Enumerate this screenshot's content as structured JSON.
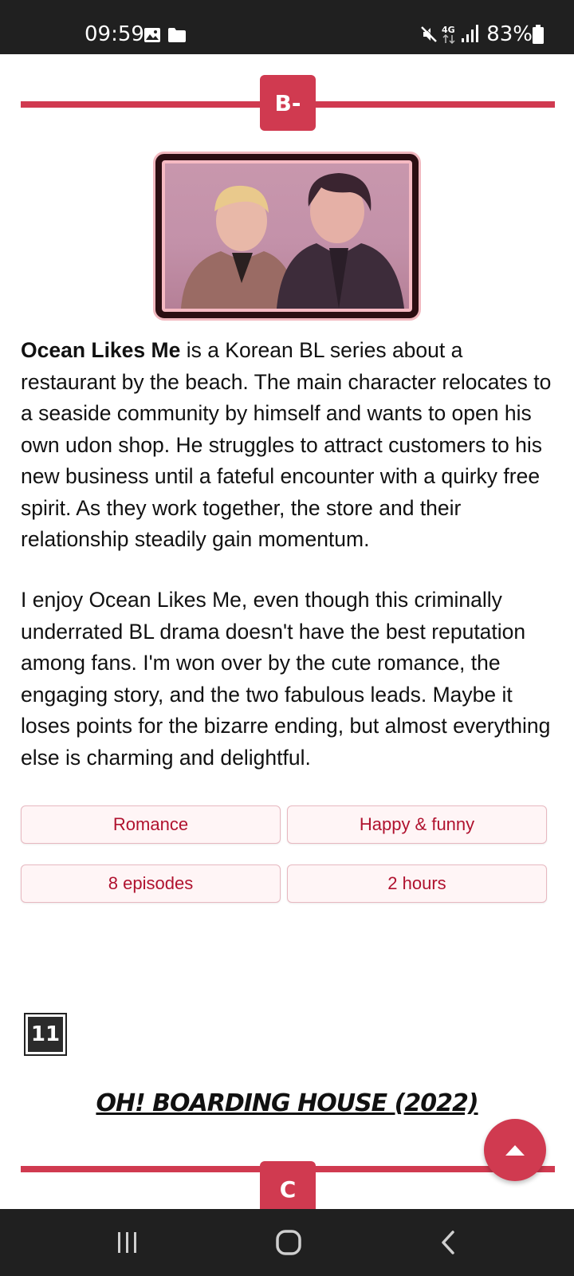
{
  "status_bar": {
    "time": "09:59",
    "network": "4G",
    "battery": "83%",
    "icons": [
      "image-icon",
      "folder-icon",
      "mute-icon",
      "network-4g-icon",
      "signal-icon",
      "battery-icon"
    ]
  },
  "review": {
    "grade": "B-",
    "title_bold": "Ocean Likes Me",
    "paragraph1_rest": " is a Korean BL series about a restaurant by the beach. The main character relocates to a seaside community by himself and wants to open his own udon shop. He struggles to attract customers to his new business until a fateful encounter with a quirky free spirit. As they work together, the store and their relationship steadily gain momentum.",
    "paragraph2": "I enjoy Ocean Likes Me, even though this criminally underrated BL drama doesn't have the best reputation among fans. I'm won over by the cute romance, the engaging story, and the two fabulous leads. Maybe it loses points for the bizarre ending, but almost everything else is charming and delightful.",
    "tags": [
      "Romance",
      "Happy & funny",
      "8 episodes",
      "2 hours"
    ]
  },
  "next_entry": {
    "rank": "11",
    "title": "OH! BOARDING HOUSE (2022)",
    "grade": "C"
  },
  "colors": {
    "accent": "#d03a50",
    "tag_text": "#b0122f",
    "tag_bg": "#fff5f6",
    "status_bar": "#202020"
  },
  "nav_bar": {
    "buttons": [
      "recent-apps-icon",
      "home-icon",
      "back-icon"
    ]
  }
}
